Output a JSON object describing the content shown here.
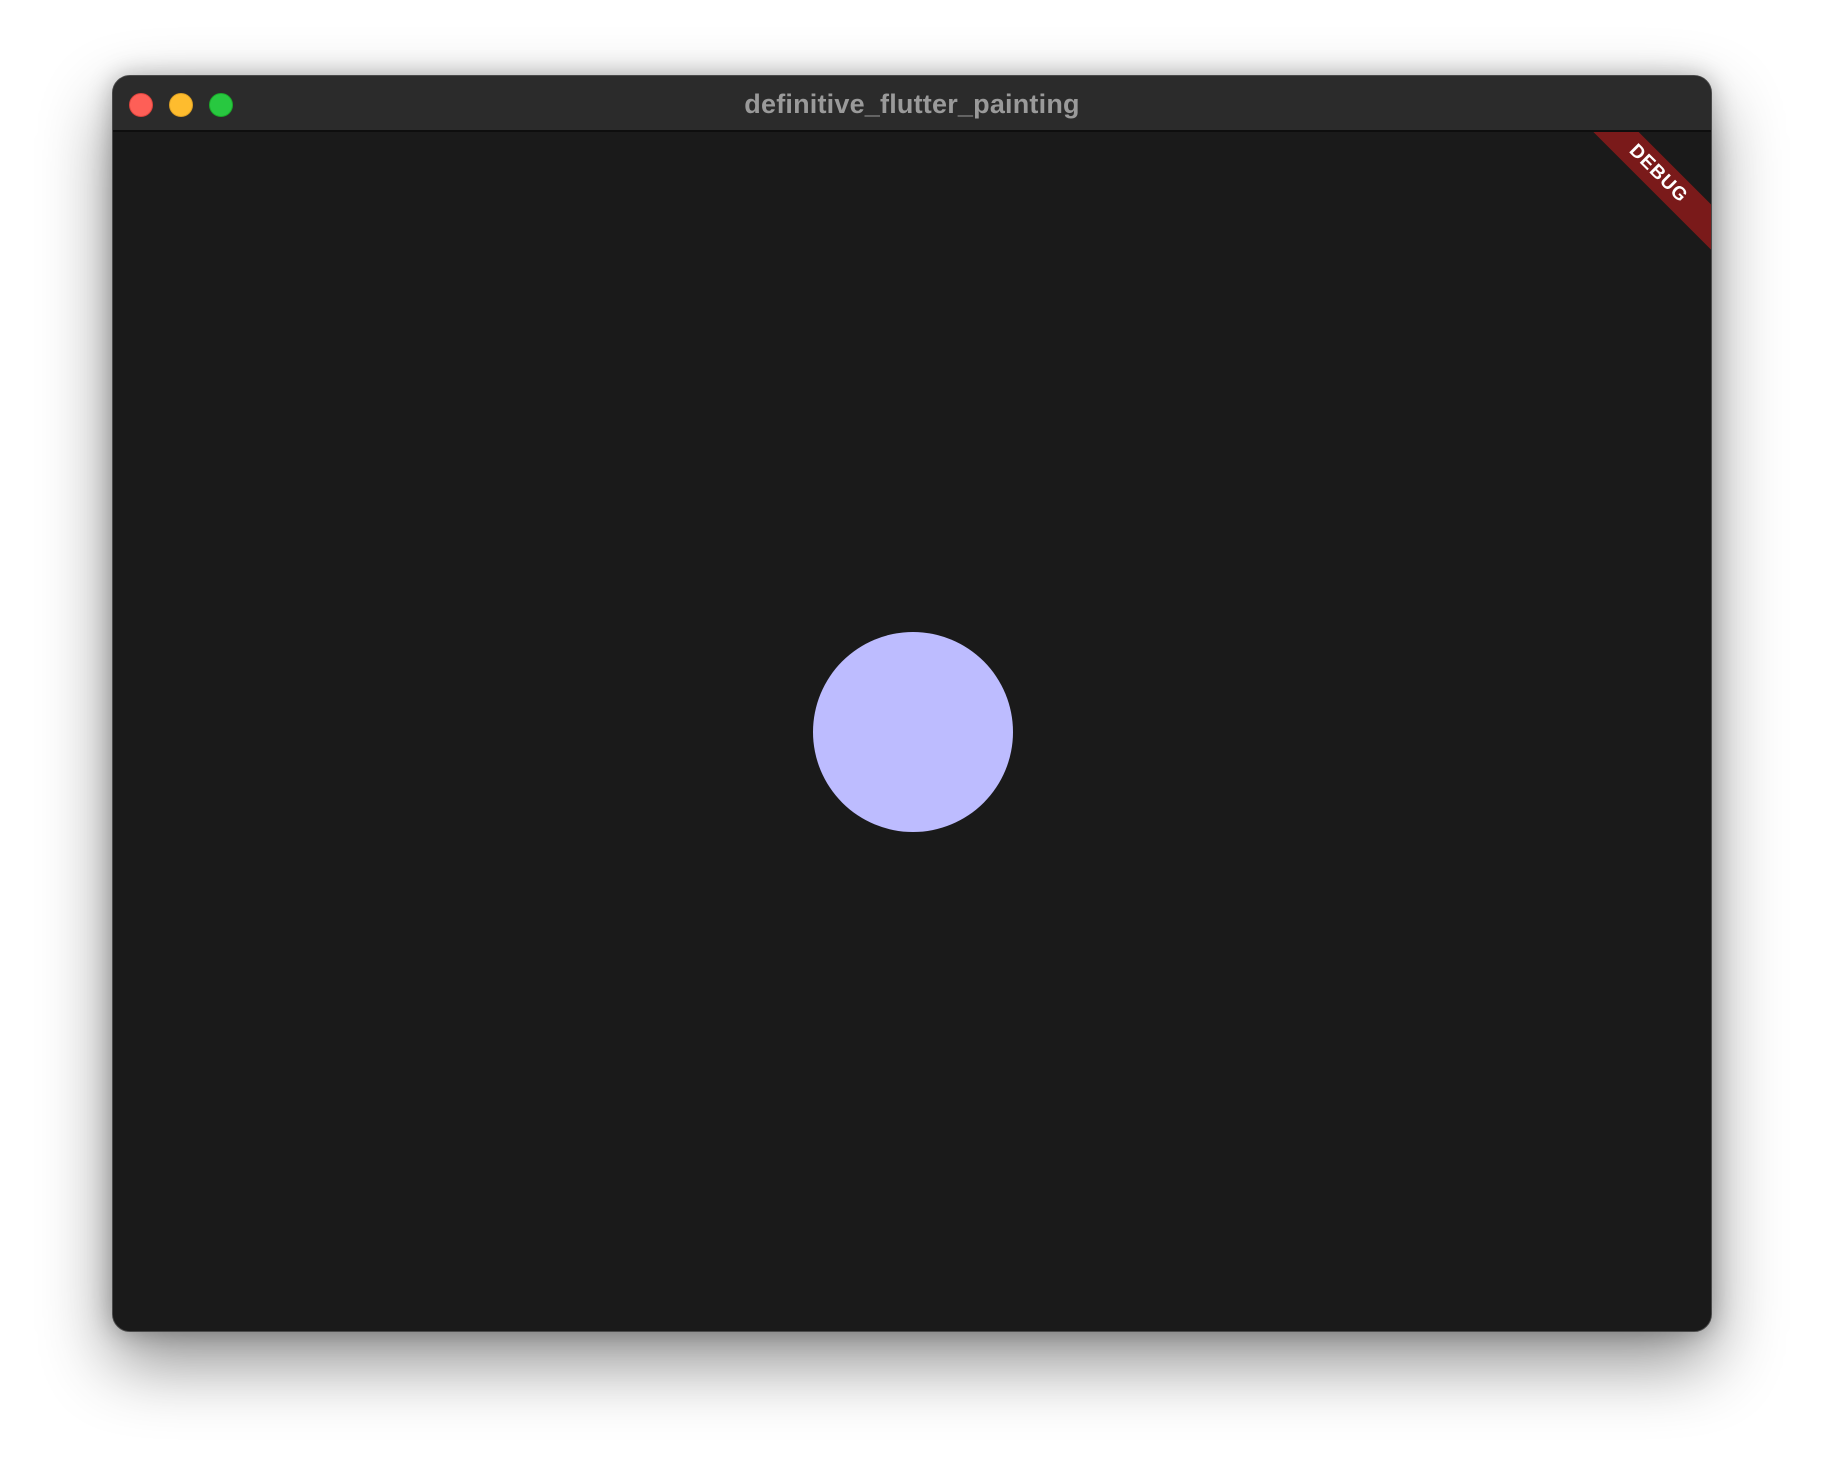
{
  "window": {
    "title": "definitive_flutter_painting",
    "traffic_lights": {
      "close_icon": "close-icon",
      "minimize_icon": "minimize-icon",
      "zoom_icon": "zoom-icon",
      "close_color": "#fe5f57",
      "minimize_color": "#febc2e",
      "zoom_color": "#28c840"
    }
  },
  "canvas": {
    "background_color": "#1a1a1a",
    "circle_color": "#bdbcff"
  },
  "debug_banner": {
    "label": "DEBUG",
    "color": "#7a1a1a"
  }
}
